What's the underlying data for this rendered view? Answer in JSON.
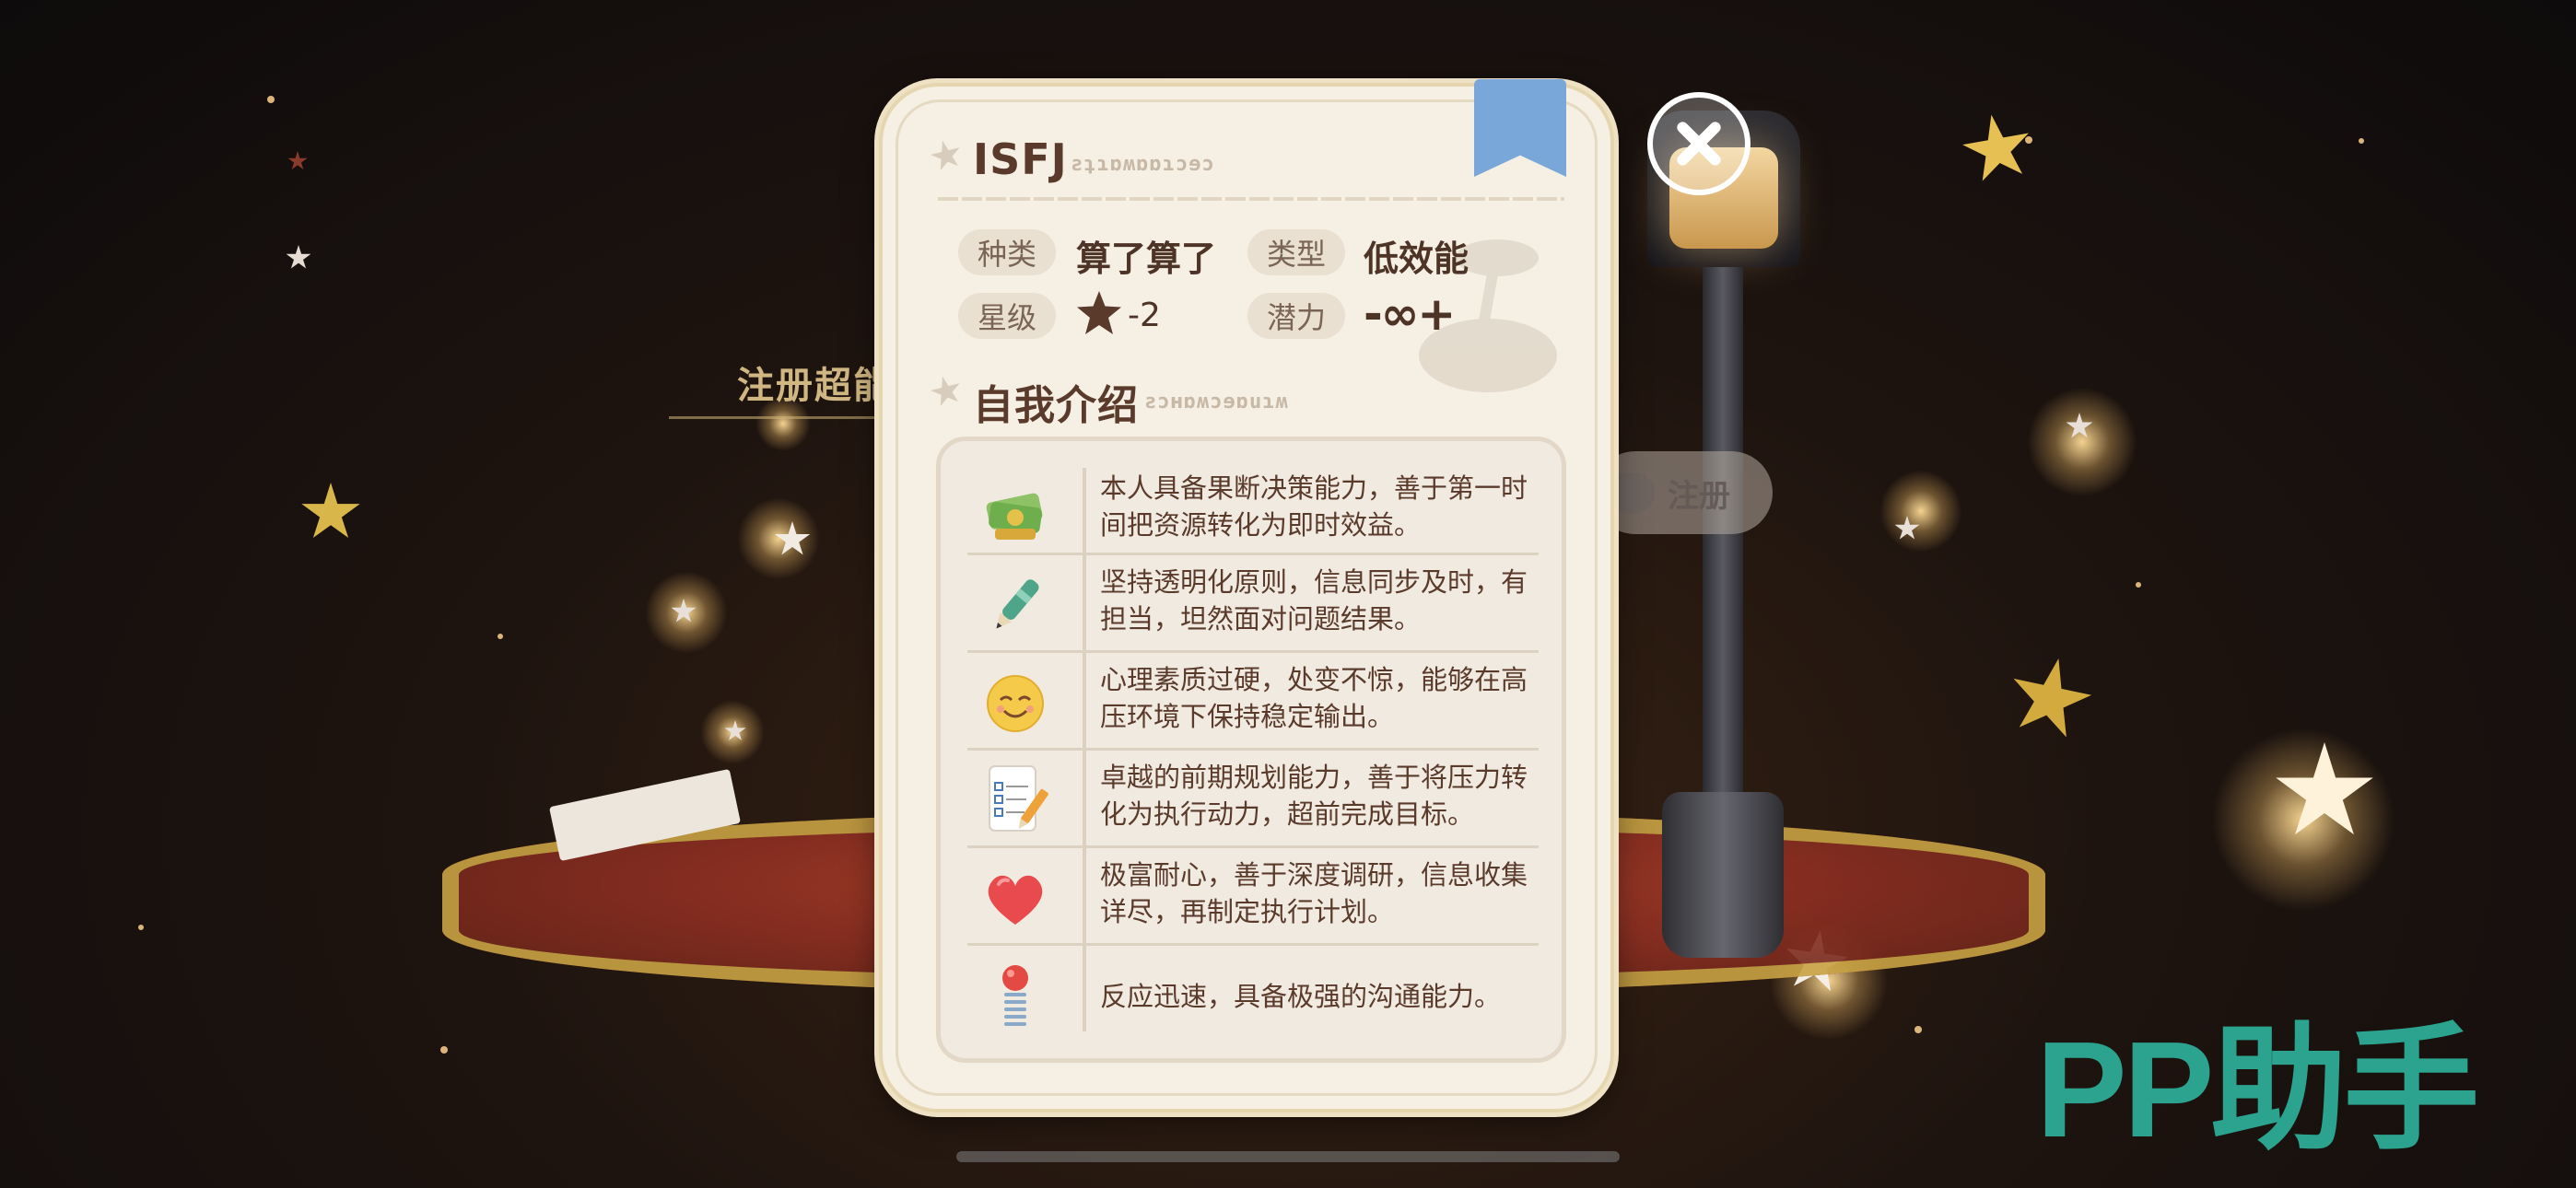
{
  "background": {
    "label": "注册超能",
    "pill_label": "注册"
  },
  "card": {
    "title": "ISFJ",
    "title_deco": "ƨʇɿɒʍɒɒɿɔɘɔ",
    "fields": {
      "kind_label": "种类",
      "kind_value": "算了算了",
      "type_label": "类型",
      "type_value": "低效能",
      "rank_label": "星级",
      "rank_value": "-2",
      "potential_label": "潜力",
      "potential_value": "-∞+"
    },
    "intro_title": "自我介绍",
    "intro_deco": "ƨɔʜɒʍɔɘɒuɿʍ",
    "traits": [
      {
        "icon": "money-icon",
        "text": "本人具备果断决策能力，善于第一时间把资源转化为即时效益。"
      },
      {
        "icon": "pen-icon",
        "text": "坚持透明化原则，信息同步及时，有担当，坦然面对问题结果。"
      },
      {
        "icon": "smiley-icon",
        "text": "心理素质过硬，处变不惊，能够在高压环境下保持稳定输出。"
      },
      {
        "icon": "todo-list-icon",
        "text": "卓越的前期规划能力，善于将压力转化为执行动力，超前完成目标。"
      },
      {
        "icon": "heart-icon",
        "text": "极富耐心，善于深度调研，信息收集详尽，再制定执行计划。"
      },
      {
        "icon": "spring-icon",
        "text": "反应迅速，具备极强的沟通能力。"
      }
    ]
  },
  "watermark": "PP助手",
  "colors": {
    "card_bg": "#f5efe4",
    "text_brown": "#5a3a2b",
    "bookmark": "#7aa7da",
    "watermark": "#2ba38f"
  }
}
